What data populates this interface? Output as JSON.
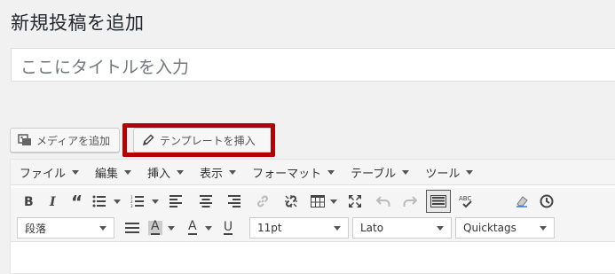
{
  "page": {
    "title": "新規投稿を追加"
  },
  "title_input": {
    "placeholder": "ここにタイトルを入力"
  },
  "buttons": {
    "add_media": "メディアを追加",
    "insert_template": "テンプレートを挿入"
  },
  "menubar": [
    "ファイル",
    "編集",
    "挿入",
    "表示",
    "フォーマット",
    "テーブル",
    "ツール"
  ],
  "toolbar1": [
    "bold",
    "italic",
    "blockquote",
    "bullet-list",
    "numbered-list",
    "align-left",
    "align-center",
    "align-right",
    "insert-link",
    "remove-link",
    "table",
    "fullscreen",
    "undo",
    "redo",
    "toolbar-toggle",
    "spellcheck",
    "clear-formatting",
    "history"
  ],
  "toolbar2": {
    "paragraph_format": "段落",
    "font_size": "11pt",
    "font_family": "Lato",
    "quicktags": "Quicktags",
    "text_bg_letter": "A",
    "text_color_letter": "A",
    "underline_letter": "U",
    "spellcheck_label": "ABC"
  },
  "colors": {
    "highlight": "#b30005",
    "text_bg": "#cccccc",
    "text_color": "#cc0000"
  }
}
